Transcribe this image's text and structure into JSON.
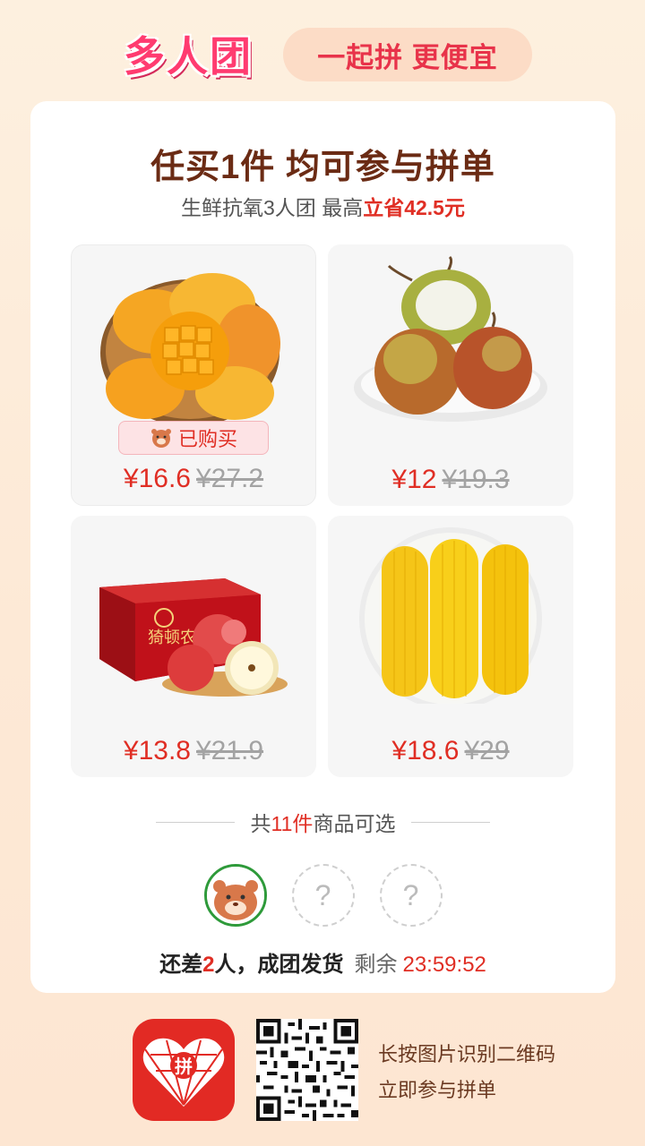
{
  "header": {
    "logo_text": "多人团",
    "slogan": "一起拼 更便宜"
  },
  "card": {
    "headline": "任买1件 均可参与拼单",
    "subline_prefix": "生鲜抗氧3人团 最高",
    "subline_highlight": "立省42.5元"
  },
  "products": [
    {
      "name": "mango",
      "price_now": "¥16.6",
      "price_old": "¥27.2",
      "tag": "已购买"
    },
    {
      "name": "pear",
      "price_now": "¥12",
      "price_old": "¥19.3"
    },
    {
      "name": "apple",
      "price_now": "¥13.8",
      "price_old": "¥21.9",
      "box_text": "猗顿农品"
    },
    {
      "name": "corn",
      "price_now": "¥18.6",
      "price_old": "¥29"
    }
  ],
  "count": {
    "prefix": "共",
    "number": "11件",
    "suffix": "商品可选"
  },
  "avatars": {
    "slot_symbol": "?"
  },
  "status": {
    "prefix": "还差",
    "number": "2",
    "suffix": "人，成团发货",
    "rest_label": "剩余",
    "timer": "23:59:52"
  },
  "footer": {
    "app_icon_text": "拼",
    "line1": "长按图片识别二维码",
    "line2": "立即参与拼单"
  },
  "colors": {
    "accent_red": "#e02e24",
    "brand_pink": "#ff3b70",
    "headline_brown": "#6b2b14",
    "app_red": "#e22a24"
  }
}
